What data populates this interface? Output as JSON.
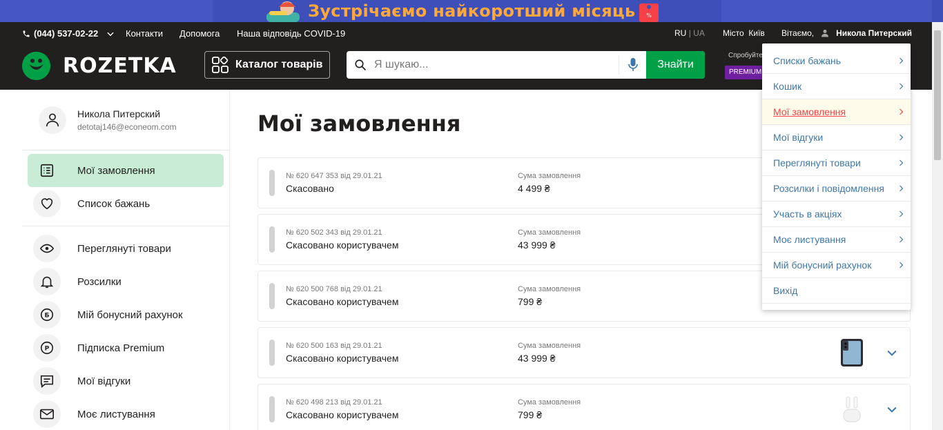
{
  "promo": {
    "text": "Зустрічаємо найкоротший місяць"
  },
  "topline": {
    "phone": "(044) 537-02-22",
    "links": [
      "Контакти",
      "Допомога",
      "Наша відповідь COVID-19"
    ],
    "lang_ru": "RU",
    "lang_sep": "|",
    "lang_ua": "UA",
    "city_label": "Місто",
    "city": "Київ",
    "greeting": "Вітаємо,",
    "user": "Никола Питерский"
  },
  "header": {
    "logo": "ROZETKA",
    "catalog": "Каталог товарів",
    "search_placeholder": "Я шукаю...",
    "search_button": "Знайти",
    "premium_hint": "Спробуйте",
    "premium_badge": "PREMIUM"
  },
  "sidebar": {
    "name": "Никола Питерский",
    "email": "detotaj146@econeom.com",
    "items": [
      {
        "label": "Мої замовлення",
        "icon": "orders-list-icon"
      },
      {
        "label": "Список бажань",
        "icon": "heart-icon"
      },
      {
        "label": "Переглянуті товари",
        "icon": "eye-icon"
      },
      {
        "label": "Розсилки",
        "icon": "bell-icon"
      },
      {
        "label": "Мій бонусний рахунок",
        "icon": "bonus-icon"
      },
      {
        "label": "Підписка Premium",
        "icon": "premium-icon"
      },
      {
        "label": "Мої відгуки",
        "icon": "reviews-icon"
      },
      {
        "label": "Моє листування",
        "icon": "mail-icon"
      }
    ]
  },
  "main": {
    "title": "Мої замовлення",
    "sum_label": "Сума замовлення",
    "orders": [
      {
        "number": "№ 620 647 353 від 29.01.21",
        "status": "Скасовано",
        "sum": "4 499 ₴"
      },
      {
        "number": "№ 620 502 343 від 29.01.21",
        "status": "Скасовано користувачем",
        "sum": "43 999 ₴"
      },
      {
        "number": "№ 620 500 768 від 29.01.21",
        "status": "Скасовано користувачем",
        "sum": "799 ₴"
      },
      {
        "number": "№ 620 500 163 від 29.01.21",
        "status": "Скасовано користувачем",
        "sum": "43 999 ₴"
      },
      {
        "number": "№ 620 498 213 від 29.01.21",
        "status": "Скасовано користувачем",
        "sum": "799 ₴"
      }
    ]
  },
  "dropdown": {
    "items": [
      "Списки бажань",
      "Кошик",
      "Мої замовлення",
      "Мої відгуки",
      "Переглянуті товари",
      "Розсилки і повідомлення",
      "Участь в акціях",
      "Моє листування",
      "Мій бонусний рахунок",
      "Вихід"
    ]
  },
  "colors": {
    "brand_green": "#00a046",
    "header_dark": "#221f1f",
    "link_blue": "#3e77aa",
    "active_red": "#f84147",
    "promo_bg": "#3e4fb9",
    "promo_text": "#ffa93c"
  }
}
